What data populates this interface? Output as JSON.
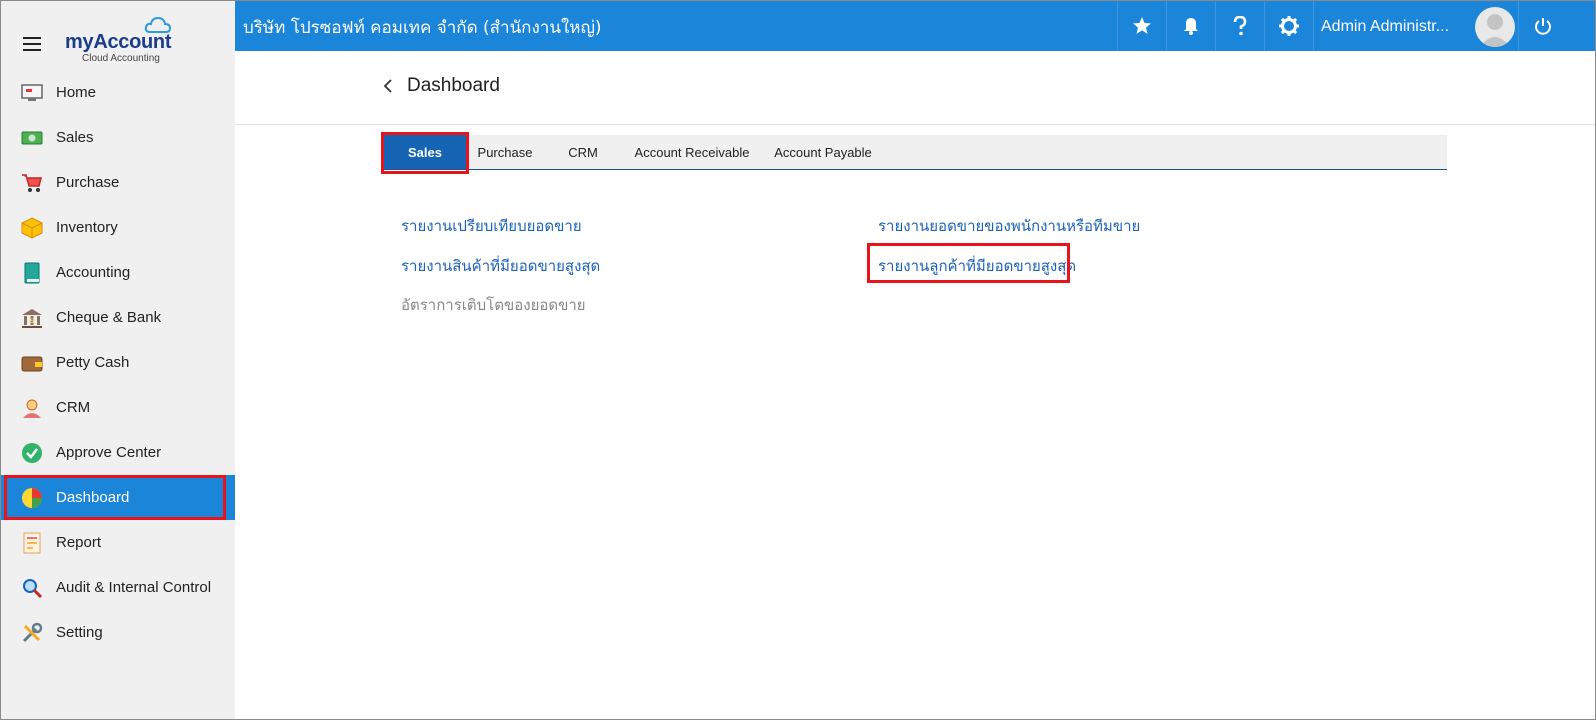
{
  "brand": {
    "name_prefix": "my",
    "name_suffix": "Account",
    "tagline": "Cloud Accounting"
  },
  "sidebar": {
    "items": [
      {
        "label": "Home",
        "icon": "monitor-icon"
      },
      {
        "label": "Sales",
        "icon": "cash-icon"
      },
      {
        "label": "Purchase",
        "icon": "cart-icon"
      },
      {
        "label": "Inventory",
        "icon": "box-icon"
      },
      {
        "label": "Accounting",
        "icon": "ledger-book-icon"
      },
      {
        "label": "Cheque & Bank",
        "icon": "bank-icon"
      },
      {
        "label": "Petty Cash",
        "icon": "wallet-icon"
      },
      {
        "label": "CRM",
        "icon": "person-icon"
      },
      {
        "label": "Approve Center",
        "icon": "check-circle-icon"
      },
      {
        "label": "Dashboard",
        "icon": "pie-chart-icon",
        "active": true
      },
      {
        "label": "Report",
        "icon": "report-icon"
      },
      {
        "label": "Audit & Internal Control",
        "icon": "magnifier-icon"
      },
      {
        "label": "Setting",
        "icon": "tools-icon"
      }
    ]
  },
  "topbar": {
    "company": "บริษัท โปรซอฟท์ คอมเทค จำกัด (สำนักงานใหญ่)",
    "user": "Admin Administr...",
    "icons": [
      "star-icon",
      "bell-icon",
      "help-icon",
      "gear-icon",
      "power-icon"
    ]
  },
  "page": {
    "title": "Dashboard"
  },
  "tabs": [
    {
      "label": "Sales",
      "active": true
    },
    {
      "label": "Purchase"
    },
    {
      "label": "CRM"
    },
    {
      "label": "Account Receivable"
    },
    {
      "label": "Account Payable"
    }
  ],
  "reports": {
    "left": [
      "รายงานเปรียบเทียบยอดขาย",
      "รายงานสินค้าที่มียอดขายสูงสุด",
      "อัตราการเติบโตของยอดขาย"
    ],
    "right": [
      "รายงานยอดขายของพนักงานหรือทีมขาย",
      "รายงานลูกค้าที่มียอดขายสูงสุด"
    ]
  },
  "colors": {
    "primary": "#1a85d9",
    "tab_active": "#1565b4",
    "link": "#1c62b8",
    "highlight": "#e8141b",
    "sidebar_bg": "#f0f0f0"
  }
}
